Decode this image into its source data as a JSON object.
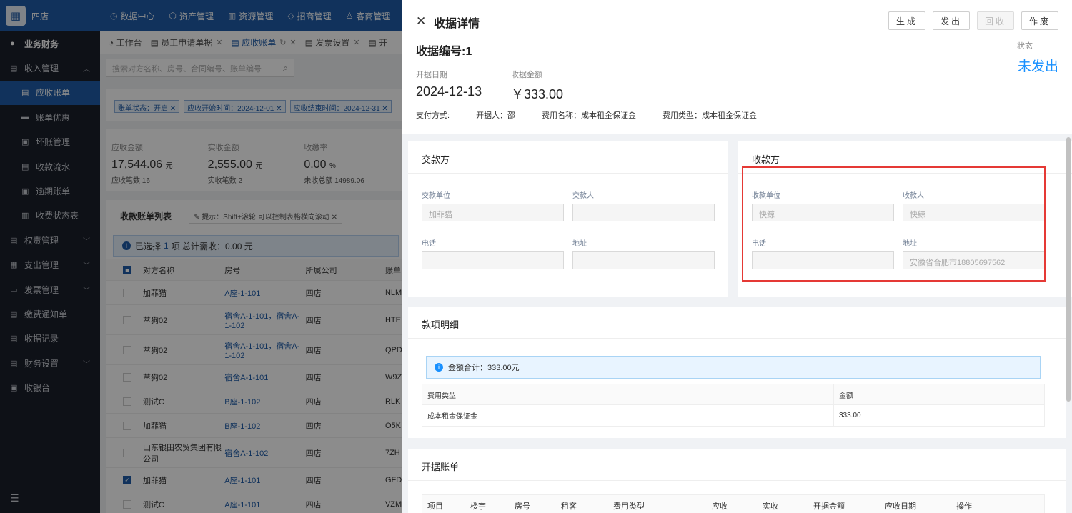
{
  "app": {
    "org_name": "四店",
    "nav": [
      "数据中心",
      "资产管理",
      "资源管理",
      "招商管理",
      "客商管理"
    ]
  },
  "sidebar": {
    "items": [
      {
        "label": "业务财务",
        "icon": "circle-icon"
      },
      {
        "label": "收入管理",
        "icon": "doc-icon"
      },
      {
        "label": "应收账单",
        "icon": "doc-icon"
      },
      {
        "label": "账单优惠",
        "icon": "ticket-icon"
      },
      {
        "label": "坏账管理",
        "icon": "doc-icon"
      },
      {
        "label": "收款流水",
        "icon": "doc-icon"
      },
      {
        "label": "逾期账单",
        "icon": "doc-icon"
      },
      {
        "label": "收费状态表",
        "icon": "doc-icon"
      },
      {
        "label": "权责管理",
        "icon": "doc-icon"
      },
      {
        "label": "支出管理",
        "icon": "doc-icon"
      },
      {
        "label": "发票管理",
        "icon": "doc-icon"
      },
      {
        "label": "缴费通知单",
        "icon": "doc-icon"
      },
      {
        "label": "收据记录",
        "icon": "doc-icon"
      },
      {
        "label": "财务设置",
        "icon": "doc-icon"
      },
      {
        "label": "收银台",
        "icon": "doc-icon"
      }
    ]
  },
  "tabs": [
    "工作台",
    "员工申请单据",
    "应收账单",
    "发票设置",
    "开"
  ],
  "search": {
    "placeholder": "搜索对方名称、房号、合同编号、账单编号"
  },
  "filters": [
    "账单状态：开启",
    "应收开始时间：2024-12-01",
    "应收结束时间：2024-12-31"
  ],
  "stats": [
    {
      "label": "应收金额",
      "value": "17,544.06",
      "unit": "元",
      "sub": "应收笔数 16"
    },
    {
      "label": "实收金额",
      "value": "2,555.00",
      "unit": "元",
      "sub": "实收笔数 2"
    },
    {
      "label": "收缴率",
      "value": "0.00",
      "unit": "%",
      "sub": "未收总额 14989.06"
    }
  ],
  "list": {
    "title": "收款账单列表",
    "hint": "提示：Shift+滚轮 可以控制表格横向滚动",
    "selected_prefix": "已选择",
    "selected_count": "1",
    "selected_suffix": "项  总计需收：0.00 元",
    "headers": [
      "对方名称",
      "房号",
      "所属公司",
      "账单"
    ],
    "rows": [
      {
        "name": "加菲猫",
        "room": "A座-1-101",
        "company": "四店",
        "code": "NLM",
        "checked": false
      },
      {
        "name": "萃狗02",
        "room": "宿舍A-1-101，宿舍A-1-102",
        "company": "四店",
        "code": "HTE",
        "checked": false
      },
      {
        "name": "萃狗02",
        "room": "宿舍A-1-101，宿舍A-1-102",
        "company": "四店",
        "code": "QPD",
        "checked": false
      },
      {
        "name": "萃狗02",
        "room": "宿舍A-1-101",
        "company": "四店",
        "code": "W9Z",
        "checked": false
      },
      {
        "name": "测试C",
        "room": "B座-1-102",
        "company": "四店",
        "code": "RLK",
        "checked": false
      },
      {
        "name": "加菲猫",
        "room": "B座-1-102",
        "company": "四店",
        "code": "O5K",
        "checked": false
      },
      {
        "name": "山东银田农贸集团有限公司",
        "room": "宿舍A-1-102",
        "company": "四店",
        "code": "7ZH",
        "checked": false
      },
      {
        "name": "加菲猫",
        "room": "A座-1-101",
        "company": "四店",
        "code": "GFD",
        "checked": true
      },
      {
        "name": "测试C",
        "room": "A座-1-101",
        "company": "四店",
        "code": "VZM",
        "checked": false
      }
    ]
  },
  "drawer": {
    "title": "收据详情",
    "buttons": [
      {
        "label": "生成",
        "disabled": false
      },
      {
        "label": "发出",
        "disabled": false
      },
      {
        "label": "回收",
        "disabled": true
      },
      {
        "label": "作废",
        "disabled": false
      }
    ],
    "receipt_no": "收据编号:1",
    "status_label": "状态",
    "status_value": "未发出",
    "date_label": "开据日期",
    "date_value": "2024-12-13",
    "amount_label": "收据金额",
    "amount_value": "￥333.00",
    "payment_method": "支付方式:",
    "issuer": "开据人：邵",
    "fee_name": "费用名称：成本租金保证金",
    "fee_type": "费用类型：成本租金保证金",
    "payer": {
      "title": "交款方",
      "unit_label": "交款单位",
      "unit_value": "加菲猫",
      "person_label": "交款人",
      "person_value": "",
      "phone_label": "电话",
      "phone_value": "",
      "address_label": "地址",
      "address_value": ""
    },
    "payee": {
      "title": "收款方",
      "unit_label": "收款单位",
      "unit_value": "快鲸",
      "person_label": "收款人",
      "person_value": "快鲸",
      "phone_label": "电话",
      "phone_value": "",
      "address_label": "地址",
      "address_value": "安徽省合肥市18805697562"
    },
    "details": {
      "title": "款项明细",
      "total": "金额合计：333.00元",
      "col_type": "费用类型",
      "col_amount": "金额",
      "rows": [
        {
          "type": "成本租金保证金",
          "amount": "333.00"
        }
      ]
    },
    "bills": {
      "title": "开据账单",
      "columns": [
        "项目",
        "楼宇",
        "房号",
        "租客",
        "费用类型",
        "应收",
        "实收",
        "开据金额",
        "应收日期",
        "操作"
      ]
    }
  }
}
